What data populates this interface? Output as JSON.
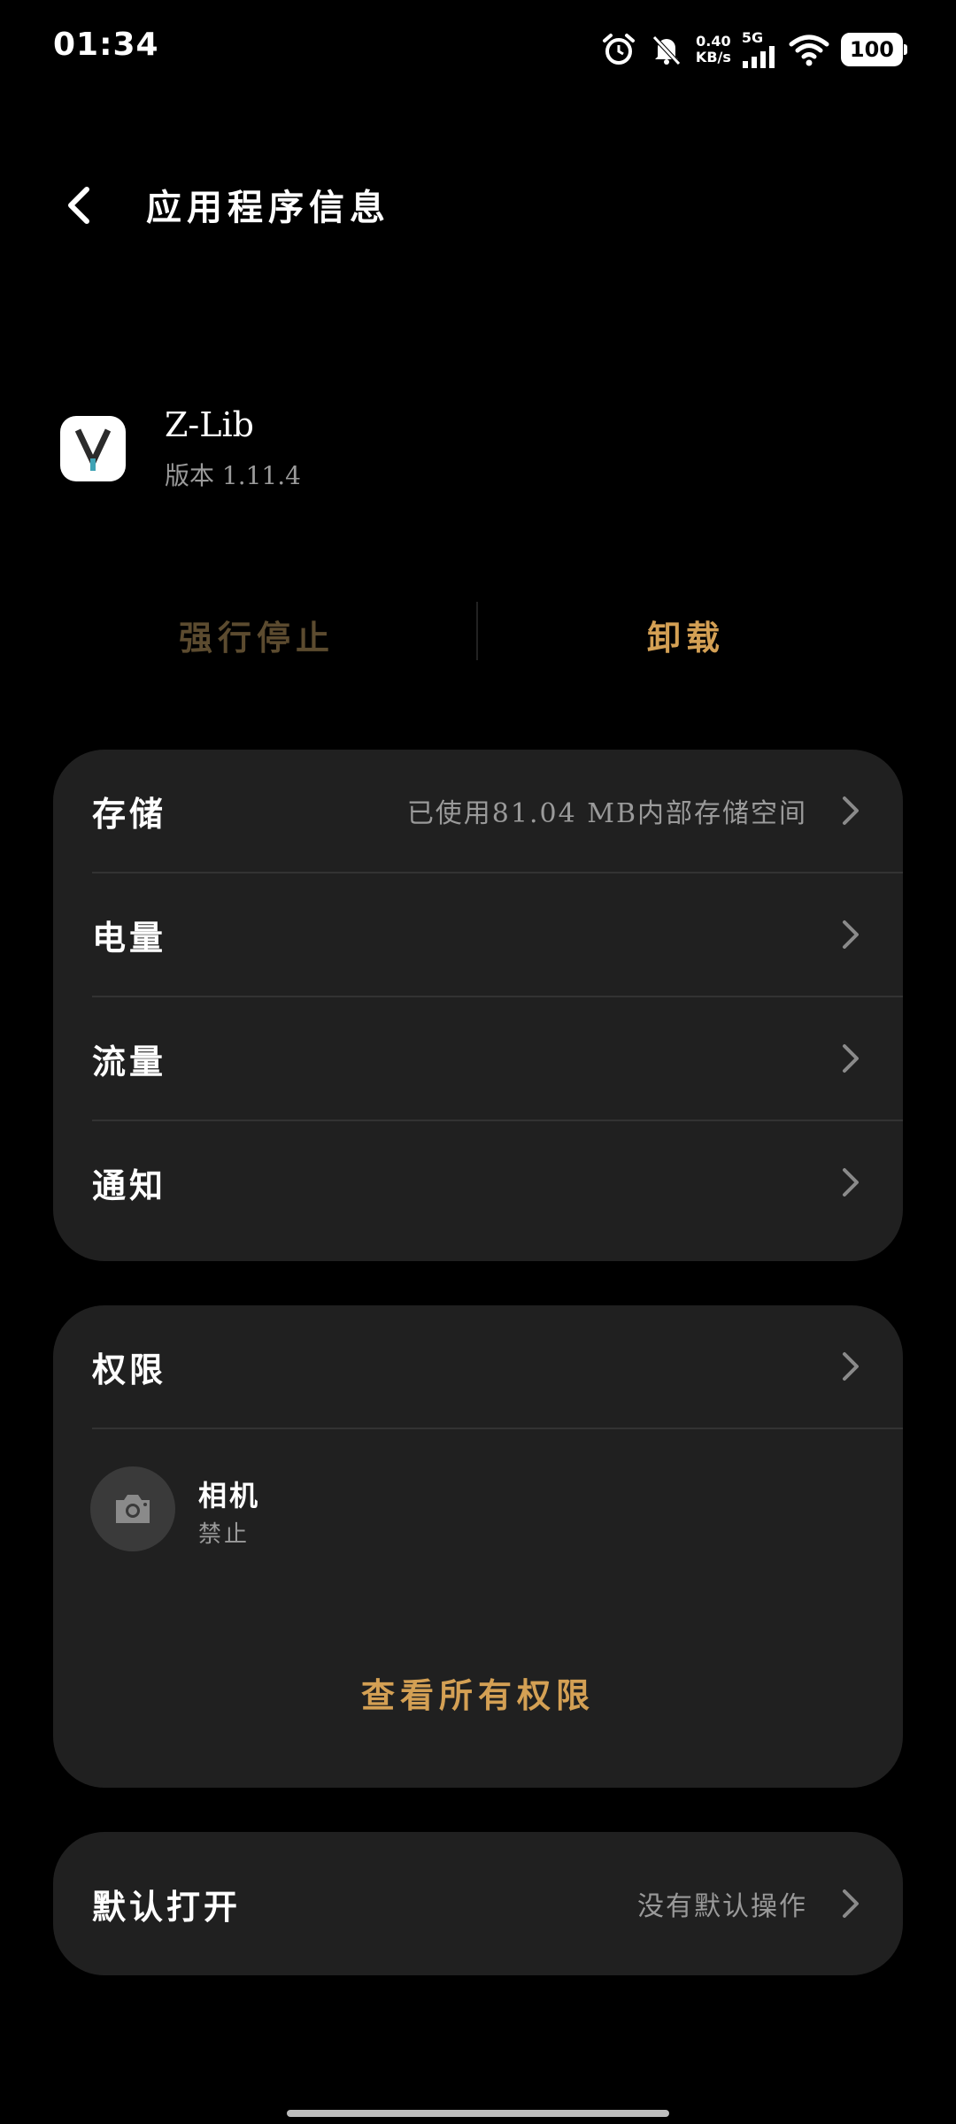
{
  "status_bar": {
    "time": "01:34",
    "net_speed_value": "0.40",
    "net_speed_unit": "KB/s",
    "network_type": "5G",
    "battery": "100",
    "icons": [
      "alarm-icon",
      "mute-bell-icon",
      "signal-icon",
      "wifi-icon",
      "battery-icon"
    ]
  },
  "header": {
    "title": "应用程序信息"
  },
  "app": {
    "name": "Z-Lib",
    "version": "版本 1.11.4"
  },
  "actions": {
    "force_stop": "强行停止",
    "uninstall": "卸载"
  },
  "usage_card": {
    "items": [
      {
        "label": "存储",
        "value": "已使用81.04 MB内部存储空间"
      },
      {
        "label": "电量",
        "value": ""
      },
      {
        "label": "流量",
        "value": ""
      },
      {
        "label": "通知",
        "value": ""
      }
    ]
  },
  "permissions_card": {
    "title": "权限",
    "items": [
      {
        "name": "相机",
        "status": "禁止",
        "icon": "camera-icon"
      }
    ],
    "view_all": "查看所有权限"
  },
  "default_open": {
    "label": "默认打开",
    "value": "没有默认操作"
  },
  "colors": {
    "background": "#000000",
    "card": "#202020",
    "accent": "#d4a054",
    "disabled_accent": "#5c4b2f",
    "secondary_text": "#9a9a9a"
  }
}
